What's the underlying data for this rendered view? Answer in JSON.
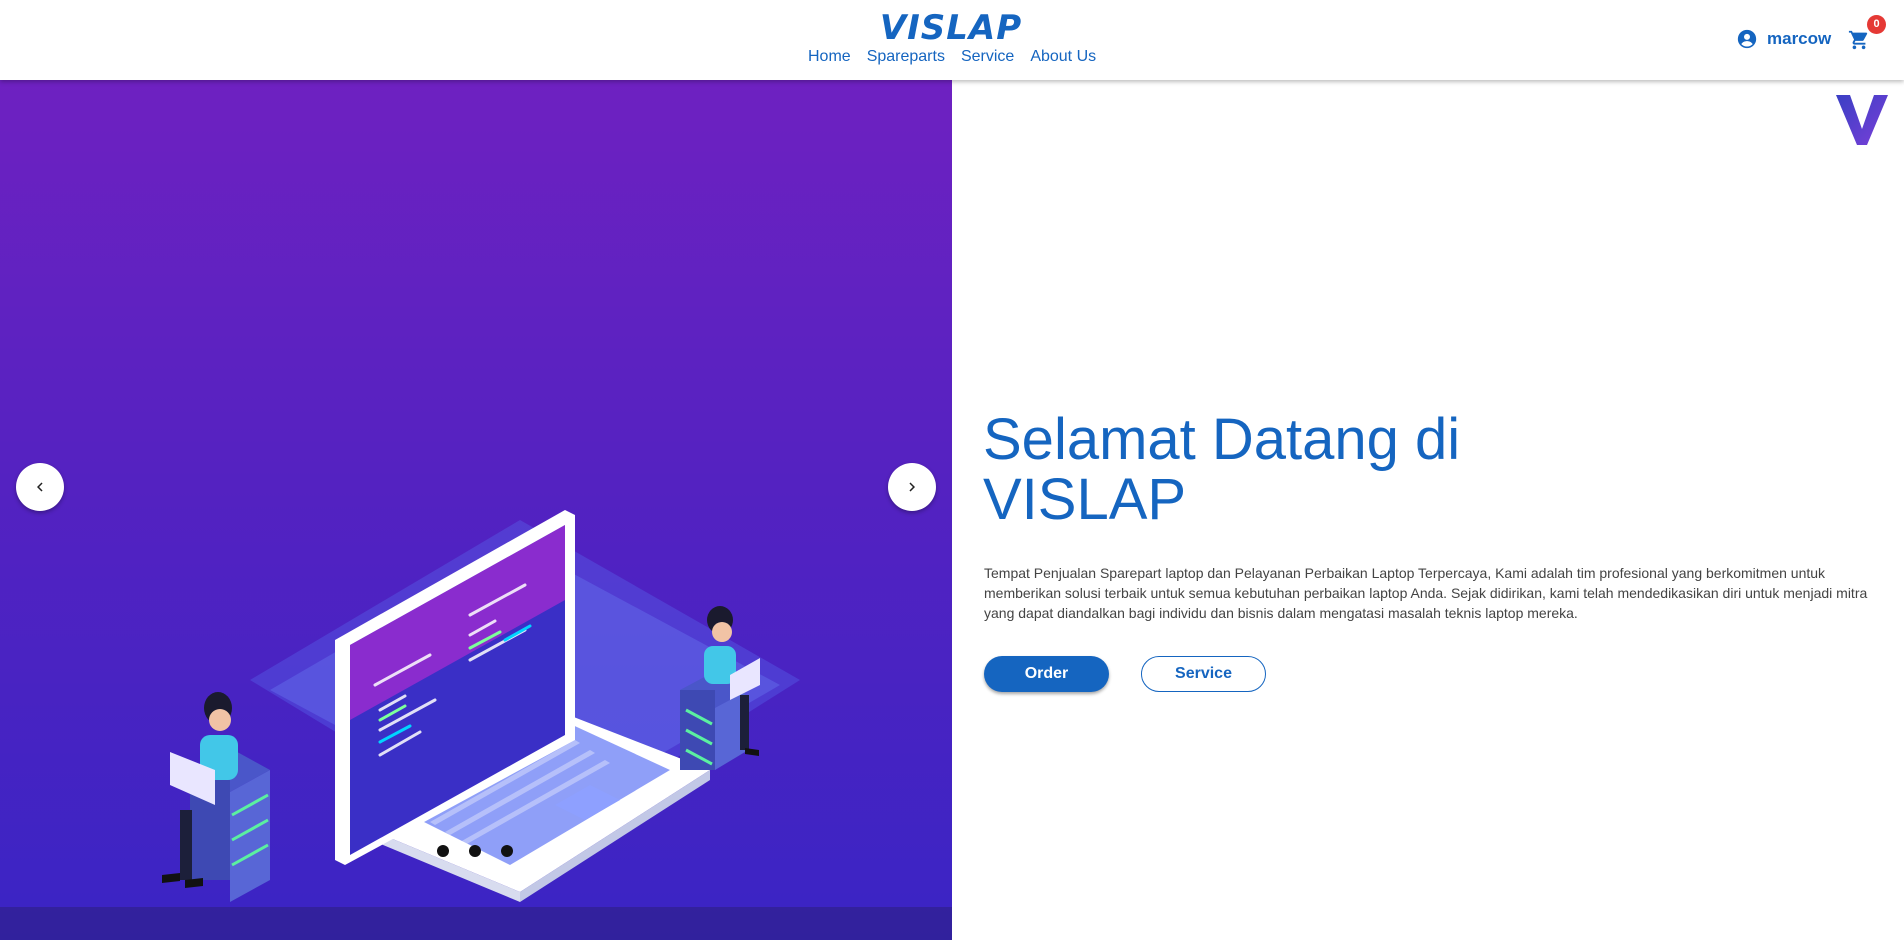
{
  "brand": {
    "logo_text": "VISLAP",
    "color": "#1565c0"
  },
  "nav": {
    "items": [
      {
        "label": "Home"
      },
      {
        "label": "Spareparts"
      },
      {
        "label": "Service"
      },
      {
        "label": "About Us"
      }
    ]
  },
  "user": {
    "name": "marcow",
    "icon": "account-circle-icon"
  },
  "cart": {
    "icon": "shopping-cart-icon",
    "count": "0"
  },
  "carousel": {
    "prev_icon": "chevron-left-icon",
    "next_icon": "chevron-right-icon",
    "slides": 3,
    "active_slide": 1
  },
  "hero": {
    "title_line1": "Selamat Datang di",
    "title_line2": "VISLAP",
    "description": "Tempat Penjualan Sparepart laptop dan Pelayanan Perbaikan Laptop Terpercaya, Kami adalah tim profesional yang berkomitmen untuk memberikan solusi terbaik untuk semua kebutuhan perbaikan laptop Anda. Sejak didirikan, kami telah mendedikasikan diri untuk menjadi mitra yang dapat diandalkan bagi individu dan bisnis dalam mengatasi masalah teknis laptop mereka.",
    "order_label": "Order",
    "service_label": "Service"
  },
  "colors": {
    "primary": "#1565c0",
    "hero_gradient_top": "#6e21c1",
    "hero_gradient_bottom": "#3a24c4",
    "badge": "#e53935"
  }
}
